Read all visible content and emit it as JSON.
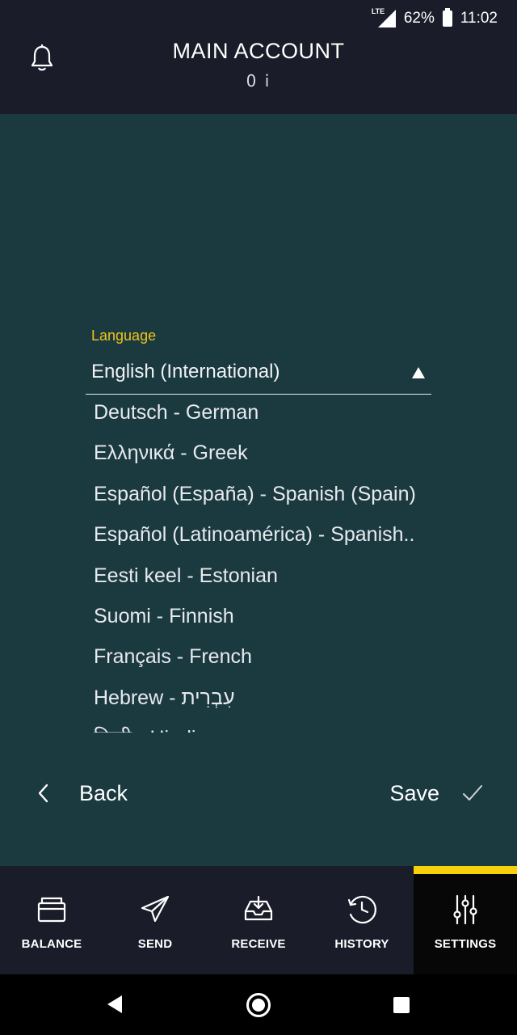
{
  "status_bar": {
    "network": "LTE",
    "battery": "62%",
    "time": "11:02"
  },
  "header": {
    "title": "MAIN ACCOUNT",
    "balance": "0 i"
  },
  "language": {
    "label": "Language",
    "selected": "English (International)",
    "options": [
      "Deutsch - German",
      "Ελληνικά - Greek",
      "Español (España) - Spanish (Spain)",
      "Español (Latinoamérica) - Spanish..",
      "Eesti keel - Estonian",
      "Suomi - Finnish",
      "Français - French",
      "Hebrew - עִבְרִית",
      "हिन्दी - Hindi"
    ]
  },
  "actions": {
    "back_label": "Back",
    "save_label": "Save"
  },
  "nav": {
    "items": [
      {
        "label": "BALANCE",
        "icon": "wallet-icon"
      },
      {
        "label": "SEND",
        "icon": "paper-plane-icon"
      },
      {
        "label": "RECEIVE",
        "icon": "inbox-icon"
      },
      {
        "label": "HISTORY",
        "icon": "history-clock-icon"
      },
      {
        "label": "SETTINGS",
        "icon": "sliders-icon"
      }
    ],
    "active": "SETTINGS"
  },
  "colors": {
    "accent": "#f7cf0a",
    "label": "#f0c419",
    "background": "#1b3a40",
    "bar": "#1a1d29"
  }
}
